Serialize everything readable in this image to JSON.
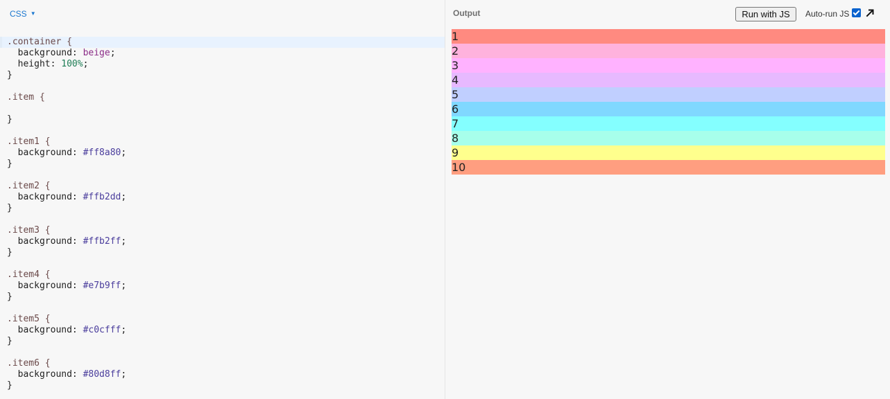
{
  "editor": {
    "language": "CSS",
    "lines": [
      [
        {
          "t": ".container {",
          "c": "sel"
        }
      ],
      [
        {
          "t": "  background: ",
          "c": "prop"
        },
        {
          "t": "beige",
          "c": "kw"
        },
        {
          "t": ";",
          "c": "prop"
        }
      ],
      [
        {
          "t": "  height: ",
          "c": "prop"
        },
        {
          "t": "100%",
          "c": "num"
        },
        {
          "t": ";",
          "c": "prop"
        }
      ],
      [
        {
          "t": "}",
          "c": "prop"
        }
      ],
      [],
      [
        {
          "t": ".item {",
          "c": "sel"
        }
      ],
      [],
      [
        {
          "t": "}",
          "c": "prop"
        }
      ],
      [],
      [
        {
          "t": ".item1 {",
          "c": "sel"
        }
      ],
      [
        {
          "t": "  background: ",
          "c": "prop"
        },
        {
          "t": "#ff8a80",
          "c": "hex"
        },
        {
          "t": ";",
          "c": "prop"
        }
      ],
      [
        {
          "t": "}",
          "c": "prop"
        }
      ],
      [],
      [
        {
          "t": ".item2 {",
          "c": "sel"
        }
      ],
      [
        {
          "t": "  background: ",
          "c": "prop"
        },
        {
          "t": "#ffb2dd",
          "c": "hex"
        },
        {
          "t": ";",
          "c": "prop"
        }
      ],
      [
        {
          "t": "}",
          "c": "prop"
        }
      ],
      [],
      [
        {
          "t": ".item3 {",
          "c": "sel"
        }
      ],
      [
        {
          "t": "  background: ",
          "c": "prop"
        },
        {
          "t": "#ffb2ff",
          "c": "hex"
        },
        {
          "t": ";",
          "c": "prop"
        }
      ],
      [
        {
          "t": "}",
          "c": "prop"
        }
      ],
      [],
      [
        {
          "t": ".item4 {",
          "c": "sel"
        }
      ],
      [
        {
          "t": "  background: ",
          "c": "prop"
        },
        {
          "t": "#e7b9ff",
          "c": "hex"
        },
        {
          "t": ";",
          "c": "prop"
        }
      ],
      [
        {
          "t": "}",
          "c": "prop"
        }
      ],
      [],
      [
        {
          "t": ".item5 {",
          "c": "sel"
        }
      ],
      [
        {
          "t": "  background: ",
          "c": "prop"
        },
        {
          "t": "#c0cfff",
          "c": "hex"
        },
        {
          "t": ";",
          "c": "prop"
        }
      ],
      [
        {
          "t": "}",
          "c": "prop"
        }
      ],
      [],
      [
        {
          "t": ".item6 {",
          "c": "sel"
        }
      ],
      [
        {
          "t": "  background: ",
          "c": "prop"
        },
        {
          "t": "#80d8ff",
          "c": "hex"
        },
        {
          "t": ";",
          "c": "prop"
        }
      ],
      [
        {
          "t": "}",
          "c": "prop"
        }
      ]
    ]
  },
  "output": {
    "title": "Output",
    "run_label": "Run with JS",
    "autorun_label": "Auto-run JS",
    "autorun_checked": true,
    "items": [
      {
        "label": "1",
        "color": "#ff8a80"
      },
      {
        "label": "2",
        "color": "#ffb2dd"
      },
      {
        "label": "3",
        "color": "#ffb2ff"
      },
      {
        "label": "4",
        "color": "#e7b9ff"
      },
      {
        "label": "5",
        "color": "#c0cfff"
      },
      {
        "label": "6",
        "color": "#80d8ff"
      },
      {
        "label": "7",
        "color": "#84ffff"
      },
      {
        "label": "8",
        "color": "#a7ffeb"
      },
      {
        "label": "9",
        "color": "#ffff8d"
      },
      {
        "label": "10",
        "color": "#ff9e80"
      }
    ]
  },
  "icons": {
    "language_caret": "chevron-down-icon",
    "expand": "arrow-up-right-icon",
    "checkbox": "checkbox-checked-icon"
  }
}
